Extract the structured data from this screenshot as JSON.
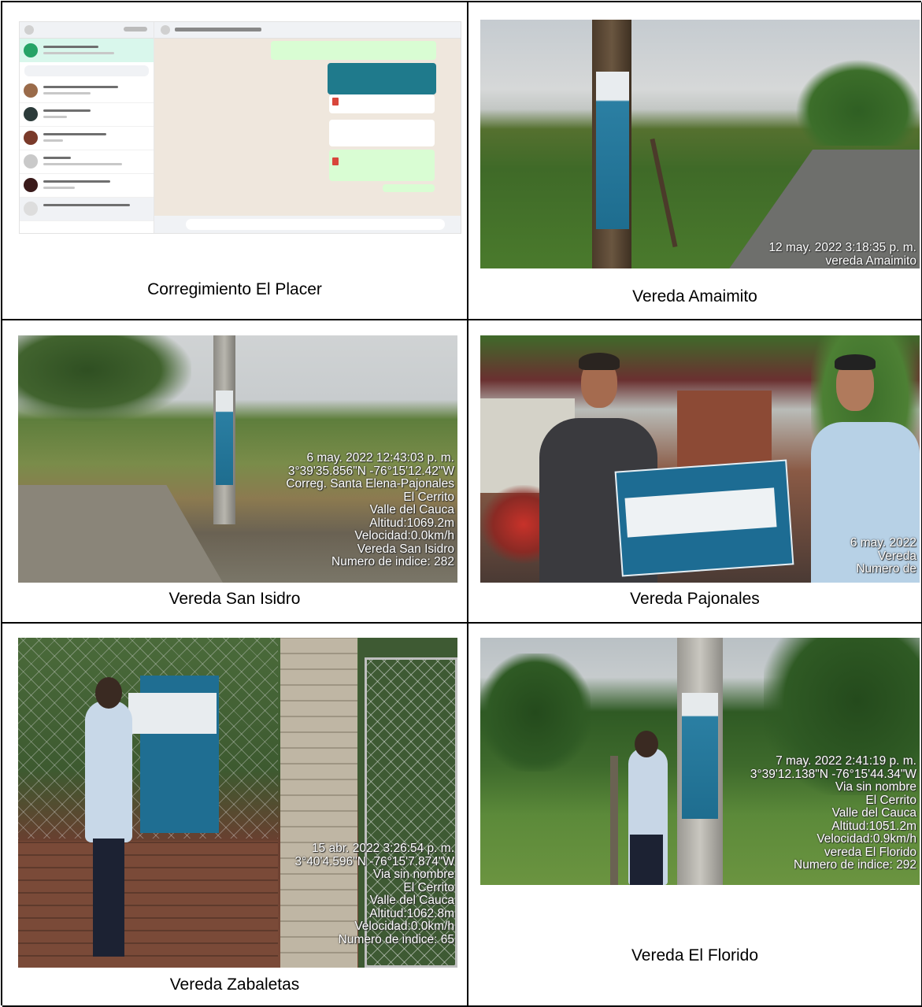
{
  "captions": {
    "el_placer": "Corregimiento El Placer",
    "amaimito": "Vereda Amaimito",
    "san_isidro": "Vereda San Isidro",
    "pajonales": "Vereda Pajonales",
    "zabaletas": "Vereda Zabaletas",
    "el_florido": "Vereda El Florido"
  },
  "stamps": {
    "amaimito": [
      "12 may. 2022 3:18:35 p. m.",
      "vereda Amaimito"
    ],
    "san_isidro": [
      "6 may. 2022 12:43:03 p. m.",
      "3°39'35.856\"N -76°15'12.42\"W",
      "Correg. Santa Elena-Pajonales",
      "El Cerrito",
      "Valle del Cauca",
      "Altitud:1069.2m",
      "Velocidad:0.0km/h",
      "Vereda San Isidro",
      "Numero de indice: 282"
    ],
    "pajonales": [
      "6 may. 2022",
      "Vereda",
      "Numero de"
    ],
    "zabaletas": [
      "15 abr. 2022 3:26:54 p. m.",
      "3°40'4.596\"N -76°15'7.874\"W",
      "Via sin nombre",
      "El Cerrito",
      "Valle del Cauca",
      "Altitud:1062.8m",
      "Velocidad:0.0km/h",
      "Numero de indice: 65"
    ],
    "el_florido": [
      "7 may. 2022 2:41:19 p. m.",
      "3°39'12.138\"N -76°15'44.34\"W",
      "Via sin nombre",
      "El Cerrito",
      "Valle del Cauca",
      "Altitud:1051.2m",
      "Velocidad:0.9km/h",
      "vereda El Florido",
      "Numero de indice: 292"
    ]
  }
}
